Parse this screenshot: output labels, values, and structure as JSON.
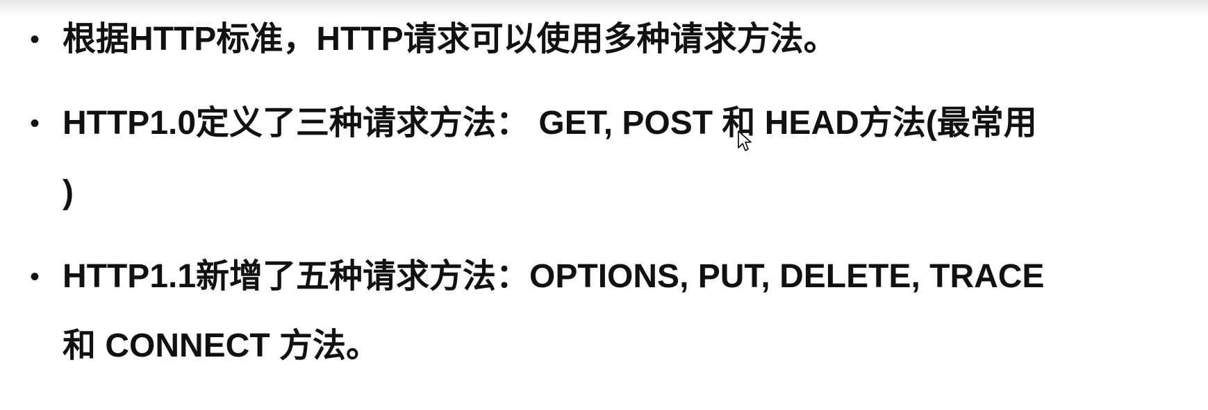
{
  "slide": {
    "bullets": [
      {
        "lines": [
          "根据HTTP标准，HTTP请求可以使用多种请求方法。"
        ]
      },
      {
        "lines": [
          "HTTP1.0定义了三种请求方法： GET, POST 和 HEAD方法(最常用",
          ")"
        ]
      },
      {
        "lines": [
          "HTTP1.1新增了五种请求方法：OPTIONS, PUT, DELETE, TRACE",
          "和 CONNECT 方法。"
        ]
      }
    ],
    "bullet_symbol": "•"
  },
  "cursor": {
    "icon": "mouse-pointer-icon"
  }
}
